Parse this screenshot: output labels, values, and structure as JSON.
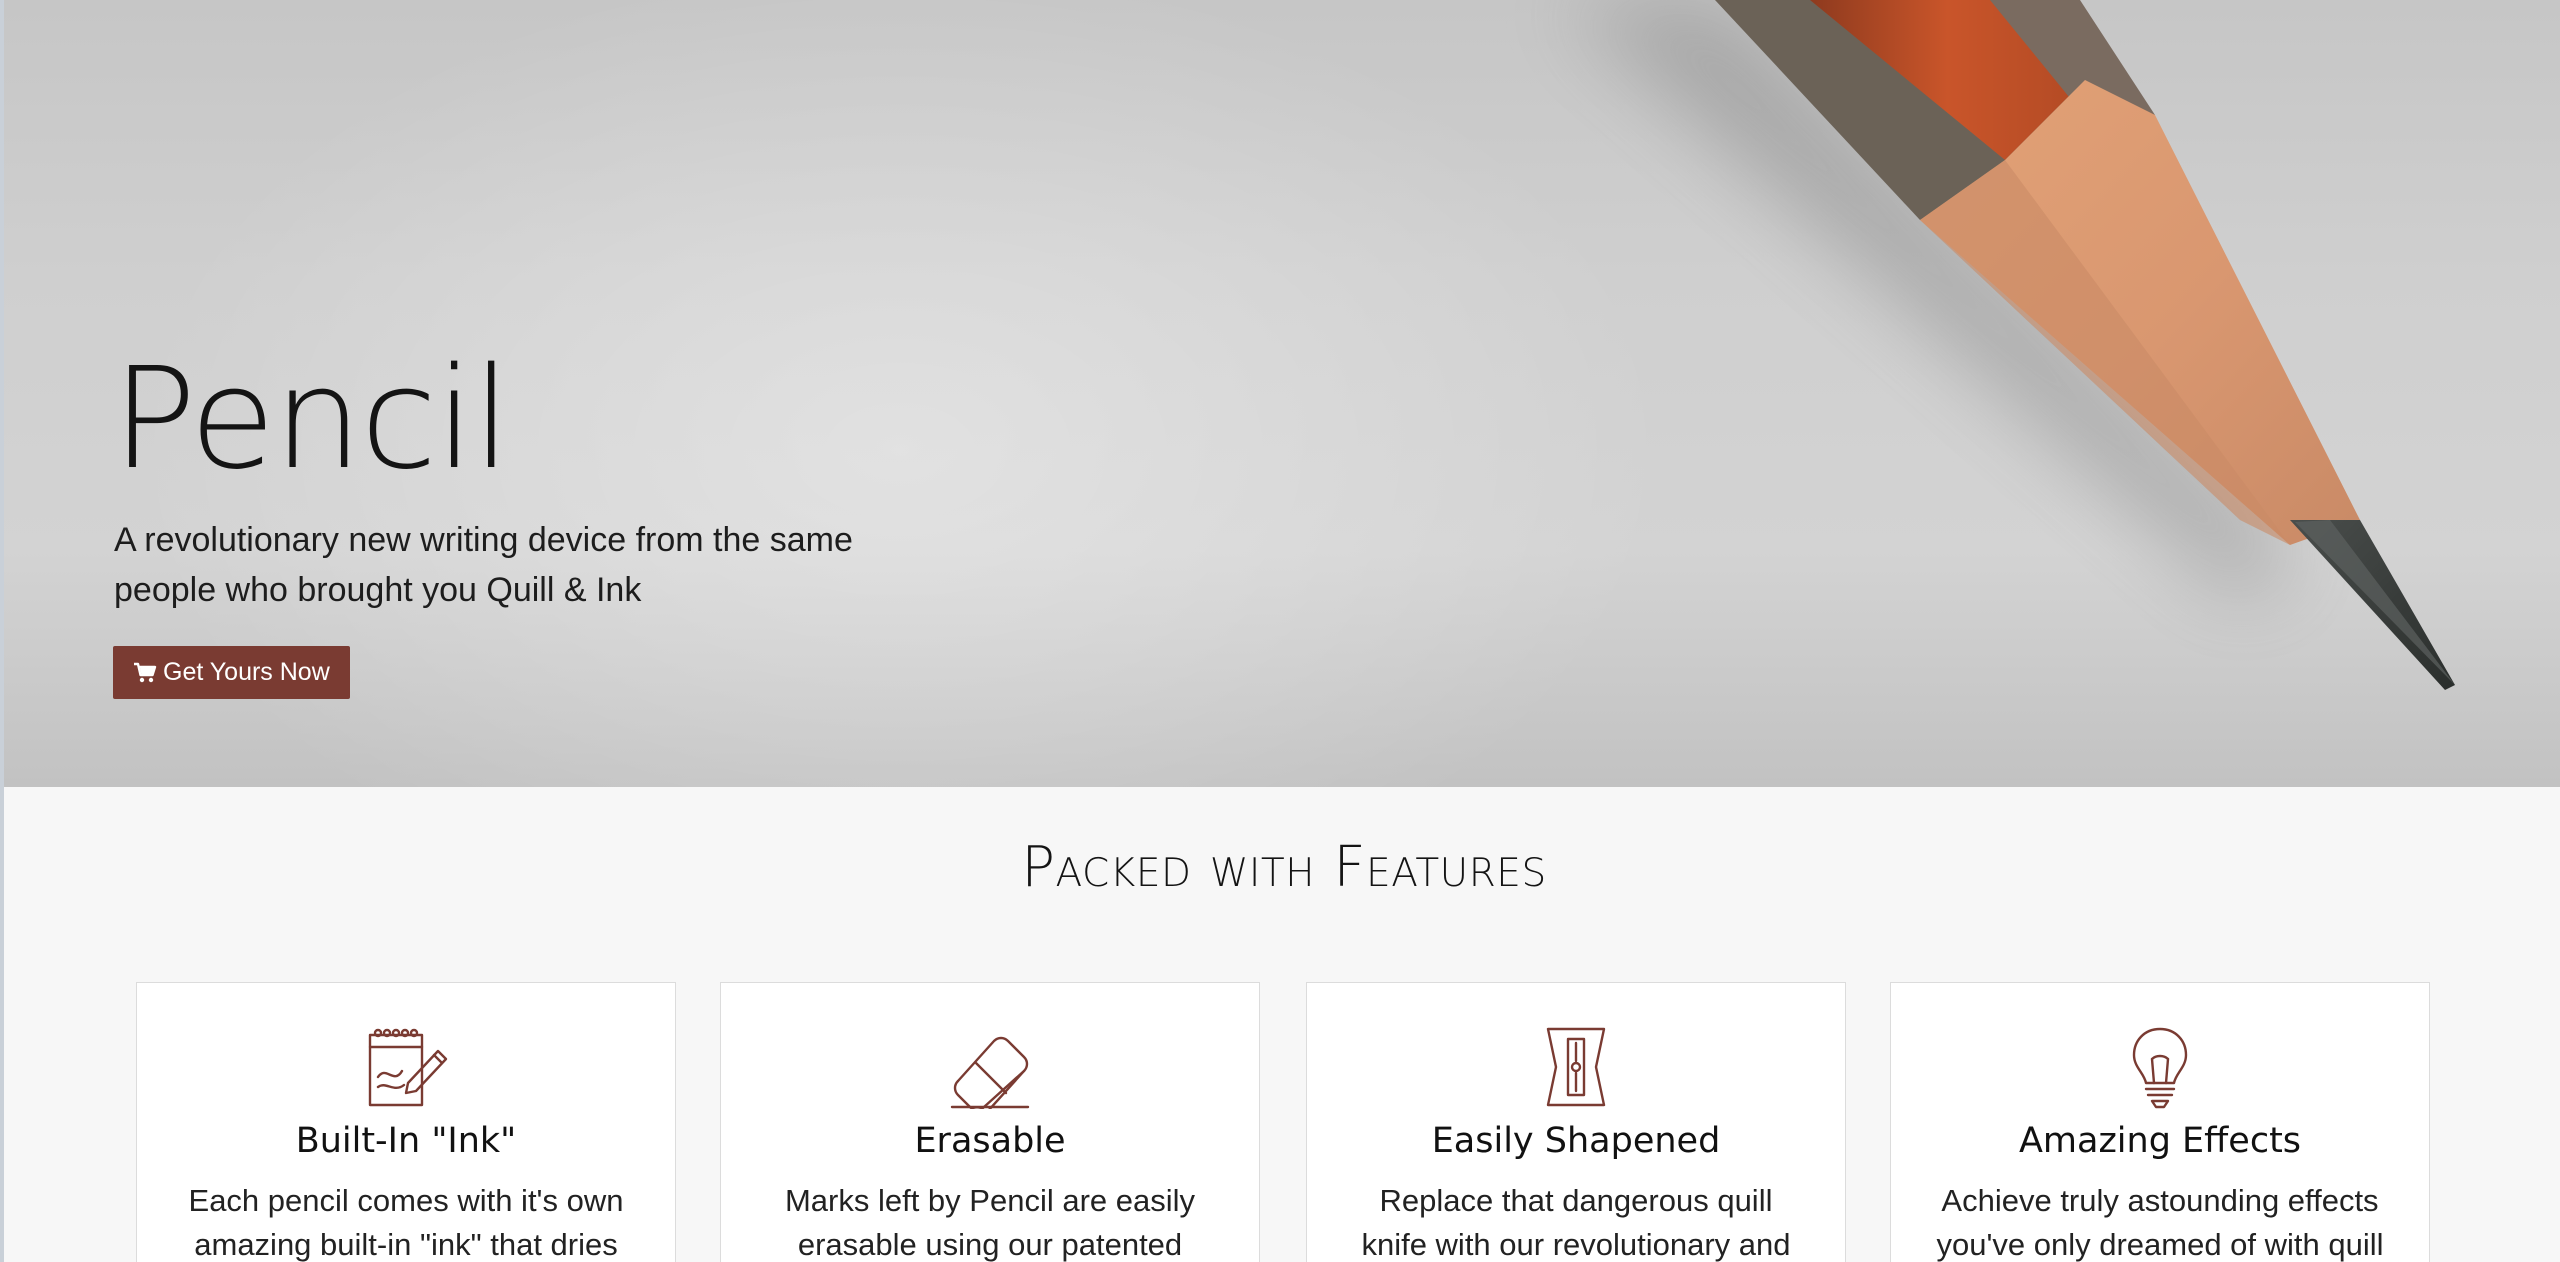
{
  "hero": {
    "title": "Pencil",
    "tagline": "A revolutionary new writing device from the same people who brought you Quill & Ink",
    "cta_label": "Get Yours Now",
    "cta_icon": "shopping-cart-icon"
  },
  "features": {
    "heading": "Packed with Features",
    "cards": [
      {
        "icon": "notepad-pencil-icon",
        "title": "Built-In \"Ink\"",
        "text": "Each pencil comes with it's own amazing built-in \"ink\" that dries"
      },
      {
        "icon": "eraser-icon",
        "title": "Erasable",
        "text": "Marks left by Pencil are easily erasable using our patented"
      },
      {
        "icon": "sharpener-icon",
        "title": "Easily Shapened",
        "text": "Replace that dangerous quill knife with our revolutionary and safe"
      },
      {
        "icon": "lightbulb-icon",
        "title": "Amazing Effects",
        "text": "Achieve truly astounding effects you've only dreamed of with quill"
      }
    ]
  },
  "colors": {
    "accent": "#7a3b32",
    "icon": "#7a3b32",
    "section_background": "#f7f7f7",
    "card_background": "#ffffff"
  }
}
